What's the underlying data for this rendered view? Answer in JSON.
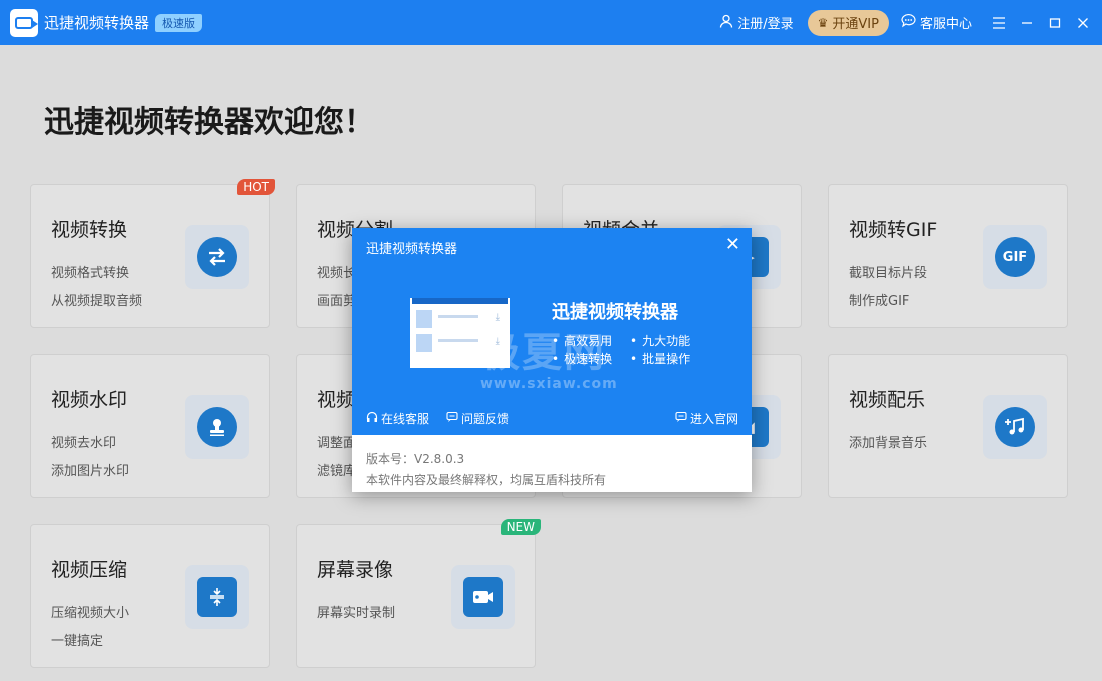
{
  "titlebar": {
    "app_title": "迅捷视频转换器",
    "edition_badge": "极速版",
    "login_label": "注册/登录",
    "vip_label": "开通VIP",
    "support_label": "客服中心",
    "menu_icon": "hamburger-icon",
    "minimize_icon": "minimize-icon",
    "maximize_icon": "maximize-icon",
    "close_icon": "close-icon"
  },
  "main": {
    "welcome": "迅捷视频转换器欢迎您！",
    "cards": [
      {
        "title": "视频转换",
        "desc1": "视频格式转换",
        "desc2": "从视频提取音频",
        "icon": "convert-arrows-icon",
        "tag": "HOT"
      },
      {
        "title": "视频分割",
        "desc1": "视频长",
        "desc2": "画面剪",
        "icon": "split-icon"
      },
      {
        "title": "视频合并",
        "desc1": "",
        "desc2": "",
        "icon": "merge-video-icon"
      },
      {
        "title": "视频转GIF",
        "desc1": "截取目标片段",
        "desc2": "制作成GIF",
        "icon": "gif-icon",
        "icon_text": "GIF"
      },
      {
        "title": "视频水印",
        "desc1": "视频去水印",
        "desc2": "添加图片水印",
        "icon": "stamp-icon"
      },
      {
        "title": "视频",
        "desc1": "调整面",
        "desc2": "滤镜库",
        "icon": "edit-icon"
      },
      {
        "title": "",
        "desc1": "",
        "desc2": "",
        "icon": "crop-icon"
      },
      {
        "title": "视频配乐",
        "desc1": "添加背景音乐",
        "desc2": "",
        "icon": "music-add-icon"
      },
      {
        "title": "视频压缩",
        "desc1": "压缩视频大小",
        "desc2": "一键搞定",
        "icon": "compress-icon"
      },
      {
        "title": "屏幕录像",
        "desc1": "屏幕实时录制",
        "desc2": "",
        "icon": "screen-record-icon",
        "tag": "NEW"
      }
    ]
  },
  "dialog": {
    "title": "迅捷视频转换器",
    "app_name": "迅捷视频转换器",
    "features": [
      "高效易用",
      "九大功能",
      "极速转换",
      "批量操作"
    ],
    "watermark": "极夏网",
    "watermark_url": "www.sxiaw.com",
    "link_support": "在线客服",
    "link_feedback": "问题反馈",
    "link_website": "进入官网",
    "version": "版本号：V2.8.0.3",
    "copyright": "本软件内容及最终解释权，均属互盾科技所有"
  }
}
